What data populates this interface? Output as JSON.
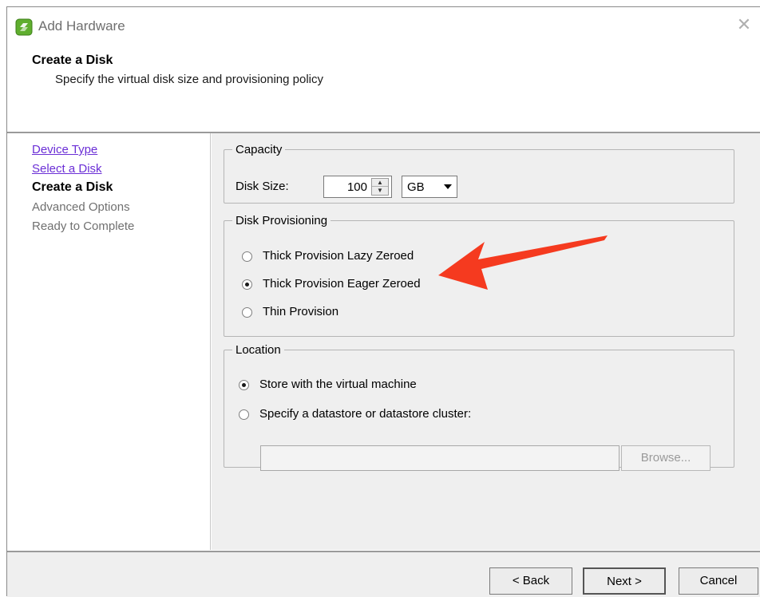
{
  "window": {
    "title": "Add Hardware",
    "close_glyph": "✕"
  },
  "header": {
    "title": "Create a Disk",
    "subtitle": "Specify the virtual disk size and provisioning policy"
  },
  "nav": {
    "items": [
      {
        "label": "Device Type",
        "state": "link"
      },
      {
        "label": "Select a Disk",
        "state": "link"
      },
      {
        "label": "Create a Disk",
        "state": "current"
      },
      {
        "label": "Advanced Options",
        "state": "disabled"
      },
      {
        "label": "Ready to Complete",
        "state": "disabled"
      }
    ]
  },
  "capacity": {
    "legend": "Capacity",
    "disk_size_label": "Disk Size:",
    "disk_size_value": "100",
    "unit": "GB"
  },
  "provisioning": {
    "legend": "Disk Provisioning",
    "options": [
      {
        "label": "Thick Provision Lazy Zeroed",
        "checked": false
      },
      {
        "label": "Thick Provision Eager Zeroed",
        "checked": true
      },
      {
        "label": "Thin Provision",
        "checked": false
      }
    ]
  },
  "location": {
    "legend": "Location",
    "options": [
      {
        "label": "Store with the virtual machine",
        "checked": true
      },
      {
        "label": "Specify a datastore or datastore cluster:",
        "checked": false
      }
    ],
    "path_value": "",
    "browse_label": "Browse..."
  },
  "footer": {
    "back_label": "< Back",
    "next_label": "Next >",
    "cancel_label": "Cancel"
  },
  "colors": {
    "annotation_arrow": "#f53a1f",
    "link": "#6b2fd6",
    "icon_green": "#5fae2e"
  }
}
